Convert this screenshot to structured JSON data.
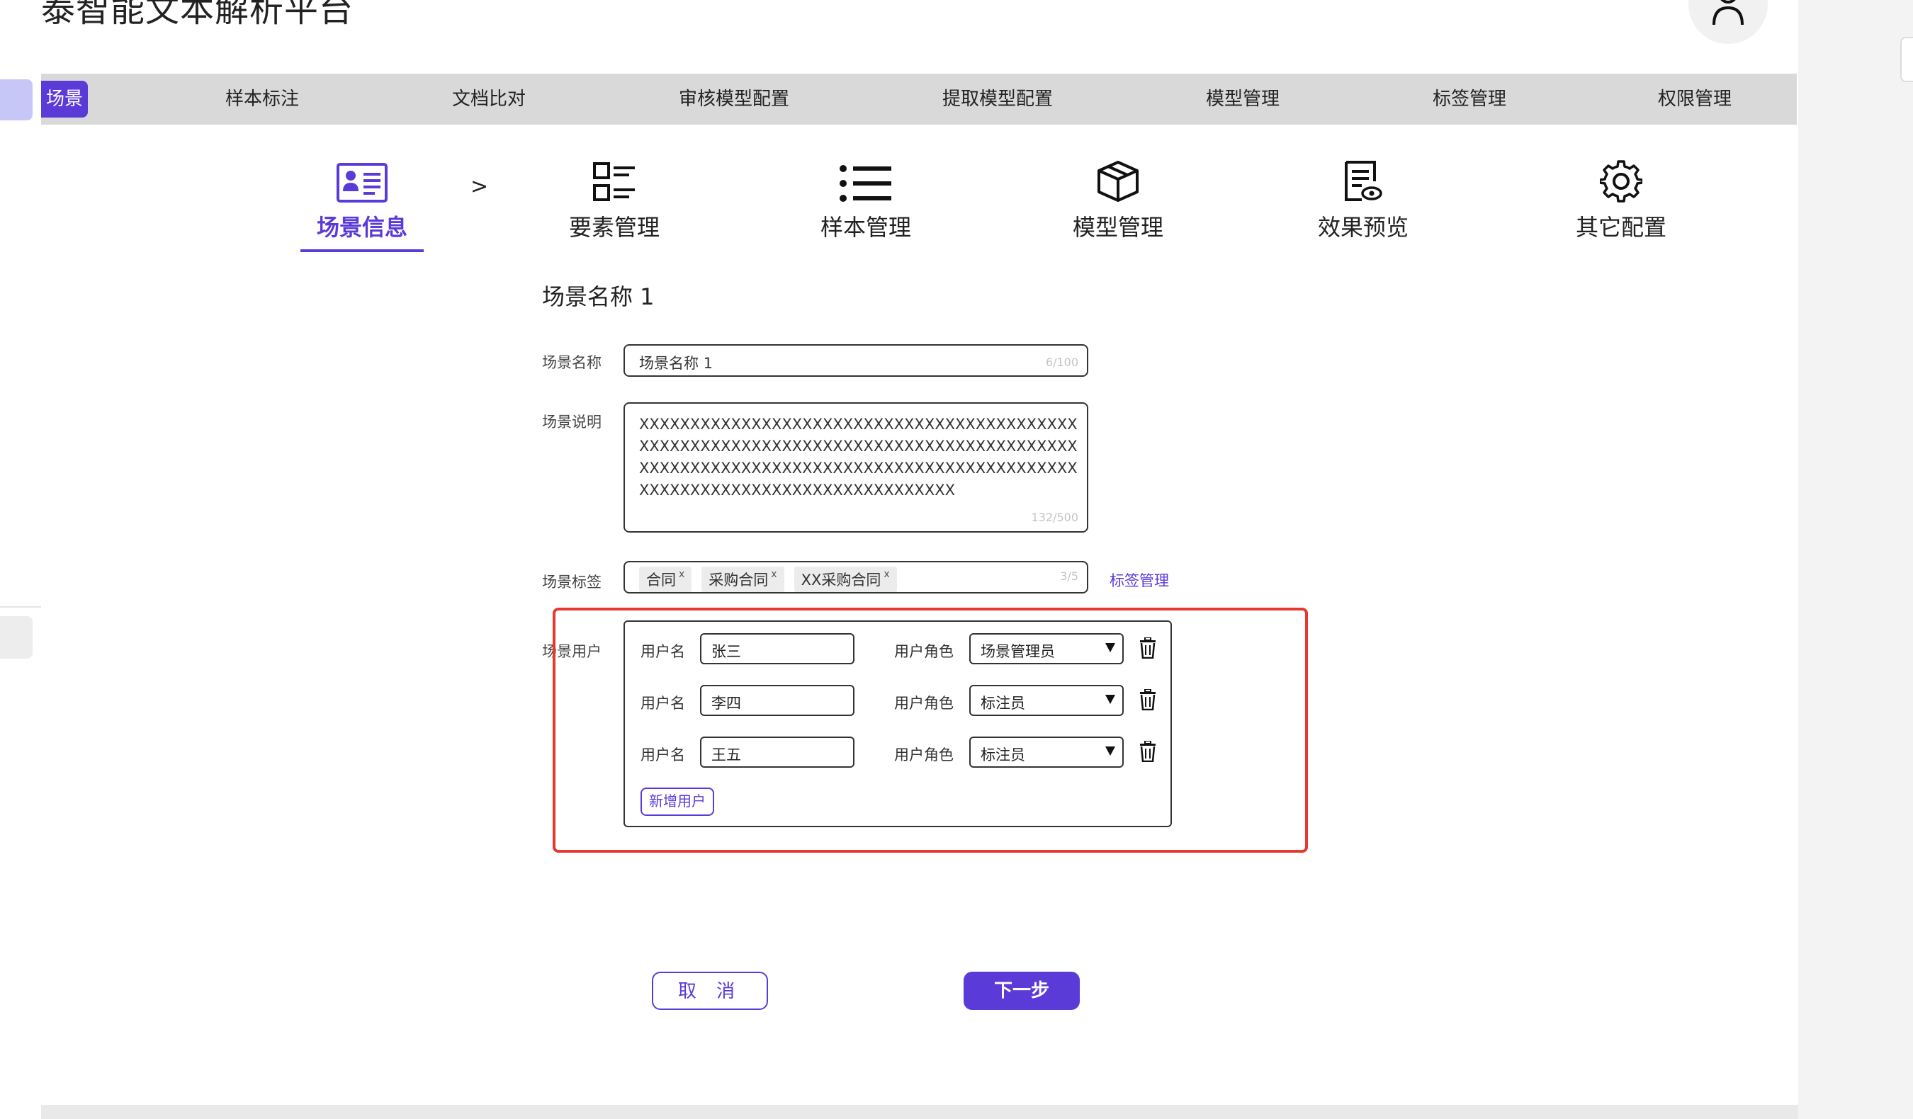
{
  "app": {
    "title": "泰智能文本解析平台"
  },
  "topnav": {
    "active": "场景",
    "items": [
      "样本标注",
      "文档比对",
      "审核模型配置",
      "提取模型配置",
      "模型管理",
      "标签管理",
      "权限管理"
    ]
  },
  "steps": {
    "separator": ">",
    "items": [
      "场景信息",
      "要素管理",
      "样本管理",
      "模型管理",
      "效果预览",
      "其它配置"
    ]
  },
  "form": {
    "title": "场景名称 1",
    "name_label": "场景名称",
    "name_value": "场景名称 1",
    "name_counter": "6/100",
    "desc_label": "场景说明",
    "desc_value": "XXXXXXXXXXXXXXXXXXXXXXXXXXXXXXXXXXXXXXXXXXXXXXXXXXXXXXXXXXXXXXXXXXXXXXXXXXXXXXXXXXXXXXXXXXXXXXXXXXXXXXXXXXXXXXXXXXXXXXXXXXXXXXXXXXXXXXXXXXXXXXXXXXXXXXXXXXXXXXXX",
    "desc_counter": "132/500",
    "tags_label": "场景标签",
    "tags": [
      "合同",
      "采购合同",
      "XX采购合同"
    ],
    "tag_remove": "x",
    "tags_counter": "3/5",
    "tag_manage_link": "标签管理",
    "users_label": "场景用户",
    "username_label": "用户名",
    "role_label": "用户角色",
    "users": [
      {
        "name": "张三",
        "role": "场景管理员"
      },
      {
        "name": "李四",
        "role": "标注员"
      },
      {
        "name": "王五",
        "role": "标注员"
      }
    ],
    "add_user": "新增用户"
  },
  "actions": {
    "cancel": "取 消",
    "next": "下一步"
  },
  "colors": {
    "accent": "#5b3bd8",
    "highlight": "#e5392f",
    "nav_bg": "#d9d9d9"
  },
  "icons": [
    "user-icon",
    "id-card-icon",
    "checklist-icon",
    "list-icon",
    "cube-icon",
    "document-preview-icon",
    "gear-icon",
    "trash-icon",
    "caret-down-icon"
  ]
}
